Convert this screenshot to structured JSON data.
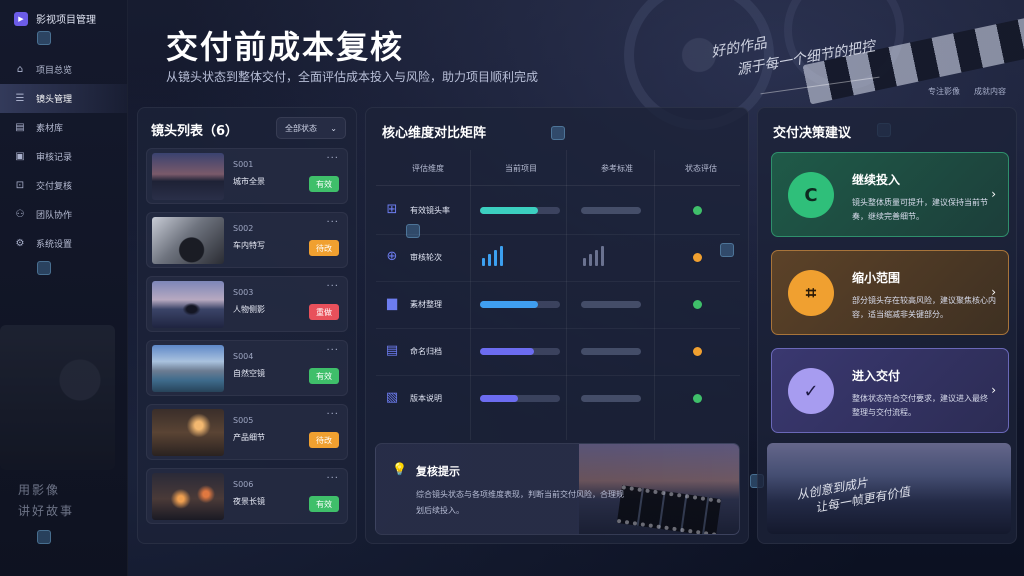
{
  "app": {
    "name": "影视项目管理"
  },
  "sidebar": {
    "items": [
      {
        "label": "项目总览",
        "icon": "home-icon"
      },
      {
        "label": "镜头管理",
        "icon": "list-icon",
        "active": true
      },
      {
        "label": "素材库",
        "icon": "folder-icon"
      },
      {
        "label": "审核记录",
        "icon": "review-icon"
      },
      {
        "label": "交付复核",
        "icon": "delivery-icon"
      },
      {
        "label": "团队协作",
        "icon": "team-icon"
      },
      {
        "label": "系统设置",
        "icon": "gear-icon"
      }
    ],
    "slogan_line1": "用影像",
    "slogan_line2": "讲好故事"
  },
  "header": {
    "title": "交付前成本复核",
    "subtitle": "从镜头状态到整体交付，全面评估成本投入与风险，助力项目顺利完成",
    "handwriting_line1": "好的作品",
    "handwriting_line2": "源于每一个细节的把控",
    "tag1": "专注影像",
    "tag2": "成就内容"
  },
  "shots": {
    "title": "镜头列表（6）",
    "filter": "全部状态",
    "items": [
      {
        "code": "S001",
        "name": "城市全景",
        "status": "有效",
        "status_color": "#3fbf6a"
      },
      {
        "code": "S002",
        "name": "车内特写",
        "status": "待改",
        "status_color": "#f0a030"
      },
      {
        "code": "S003",
        "name": "人物侧影",
        "status": "重做",
        "status_color": "#e8505b"
      },
      {
        "code": "S004",
        "name": "自然空镜",
        "status": "有效",
        "status_color": "#3fbf6a"
      },
      {
        "code": "S005",
        "name": "产品细节",
        "status": "待改",
        "status_color": "#f0a030"
      },
      {
        "code": "S006",
        "name": "夜景长镜",
        "status": "有效",
        "status_color": "#3fbf6a"
      }
    ]
  },
  "matrix": {
    "title": "核心维度对比矩阵",
    "columns": [
      "评估维度",
      "当前项目",
      "参考标准",
      "状态评估"
    ],
    "rows": [
      {
        "label": "有效镜头率",
        "icon": "plus-square-icon",
        "current": 0.72,
        "current_color": "#3ccfc0",
        "reference": 0.6,
        "status_color": "#3fbf6a"
      },
      {
        "label": "审核轮次",
        "icon": "search-icon",
        "current": null,
        "spark": true,
        "status_color": "#f0a030"
      },
      {
        "label": "素材整理",
        "icon": "folder-icon",
        "current": 0.72,
        "current_color": "#3f9ef0",
        "reference": 0.6,
        "status_color": "#3fbf6a"
      },
      {
        "label": "命名归档",
        "icon": "document-icon",
        "current": 0.68,
        "current_color": "#6c6cf0",
        "reference": 0.6,
        "status_color": "#f0a030"
      },
      {
        "label": "版本说明",
        "icon": "message-icon",
        "current": 0.48,
        "current_color": "#6c6cf0",
        "reference": 0.6,
        "status_color": "#3fbf6a"
      }
    ]
  },
  "tip": {
    "title": "复核提示",
    "text": "综合镜头状态与各项维度表现，判断当前交付风险，合理规划后续投入。"
  },
  "decision": {
    "title": "交付决策建议",
    "cards": [
      {
        "title": "继续投入",
        "text": "镜头整体质量可提升，建议保持当前节奏，继续完善细节。",
        "icon_glyph": "C"
      },
      {
        "title": "缩小范围",
        "text": "部分镜头存在较高风险，建议聚焦核心内容，适当缩减非关键部分。",
        "icon_glyph": "⌗"
      },
      {
        "title": "进入交付",
        "text": "整体状态符合交付要求，建议进入最终整理与交付流程。",
        "icon_glyph": "✓"
      }
    ],
    "scene_line1": "从创意到成片",
    "scene_line2": "让每一帧更有价值"
  }
}
